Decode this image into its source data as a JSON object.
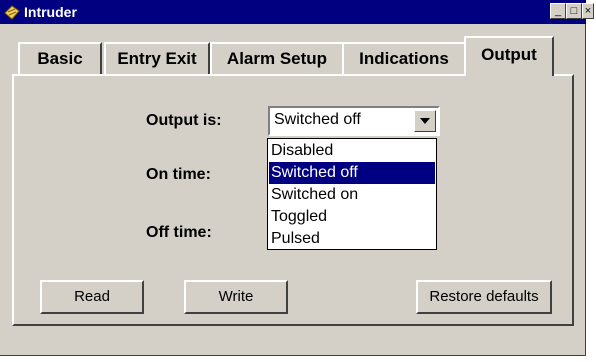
{
  "window": {
    "title": "Intruder",
    "minimize": "_",
    "maximize": "□",
    "close": "×"
  },
  "tabs": [
    {
      "label": "Basic"
    },
    {
      "label": "Entry Exit"
    },
    {
      "label": "Alarm Setup"
    },
    {
      "label": "Indications"
    },
    {
      "label": "Output",
      "active": true
    }
  ],
  "form": {
    "output_label": "Output is:",
    "on_time_label": "On time:",
    "off_time_label": "Off time:",
    "output_value": "Switched off",
    "options": [
      "Disabled",
      "Switched off",
      "Switched on",
      "Toggled",
      "Pulsed"
    ],
    "selected_option": "Switched off"
  },
  "buttons": {
    "read": "Read",
    "write": "Write",
    "restore": "Restore defaults"
  },
  "colors": {
    "titlebar": "#000080",
    "face": "#d4d0c8",
    "highlight": "#000080"
  },
  "icons": {
    "app": "intruder-app-icon",
    "dropdown": "chevron-down-icon"
  }
}
